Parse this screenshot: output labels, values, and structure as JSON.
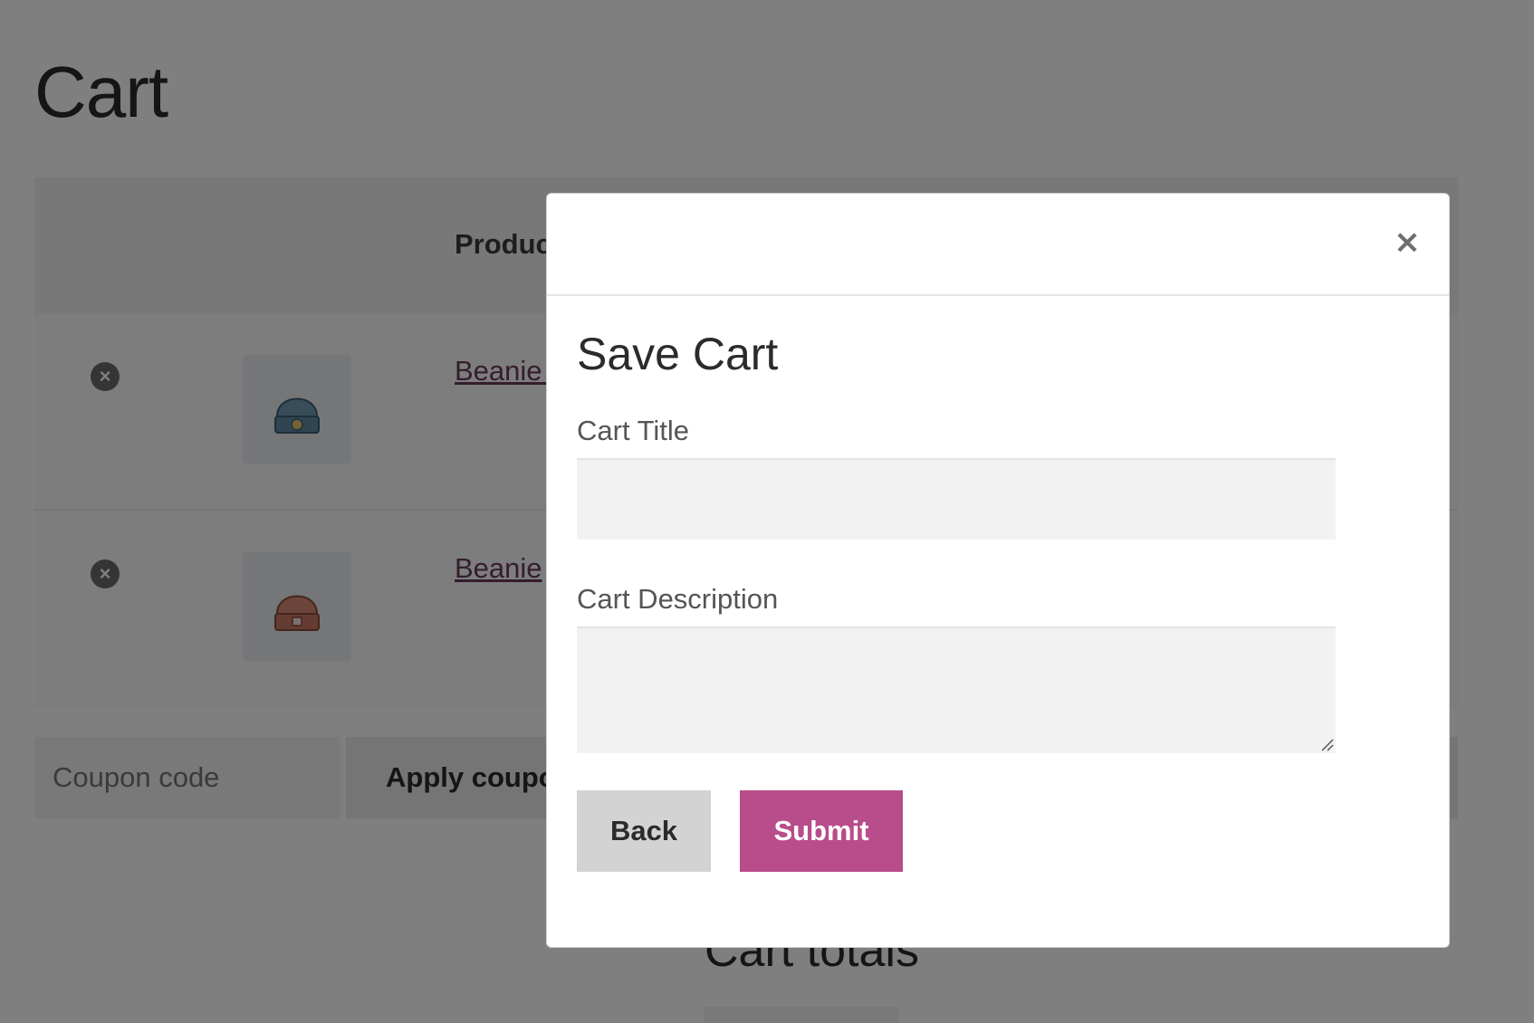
{
  "page": {
    "title": "Cart",
    "table": {
      "product_header": "Product"
    },
    "items": [
      {
        "name": "Beanie with Logo",
        "remove_icon": "close-circle-icon",
        "color": "#6f9bb5"
      },
      {
        "name": "Beanie",
        "remove_icon": "close-circle-icon",
        "color": "#d98a74"
      }
    ],
    "coupon": {
      "placeholder": "Coupon code",
      "apply_label": "Apply coupon"
    },
    "totals_heading": "Cart totals"
  },
  "modal": {
    "close_symbol": "×",
    "title": "Save Cart",
    "title_field": {
      "label": "Cart Title",
      "value": ""
    },
    "description_field": {
      "label": "Cart Description",
      "value": ""
    },
    "back_label": "Back",
    "submit_label": "Submit"
  },
  "colors": {
    "accent": "#b94c8b",
    "overlay": "rgba(0,0,0,0.5)"
  }
}
